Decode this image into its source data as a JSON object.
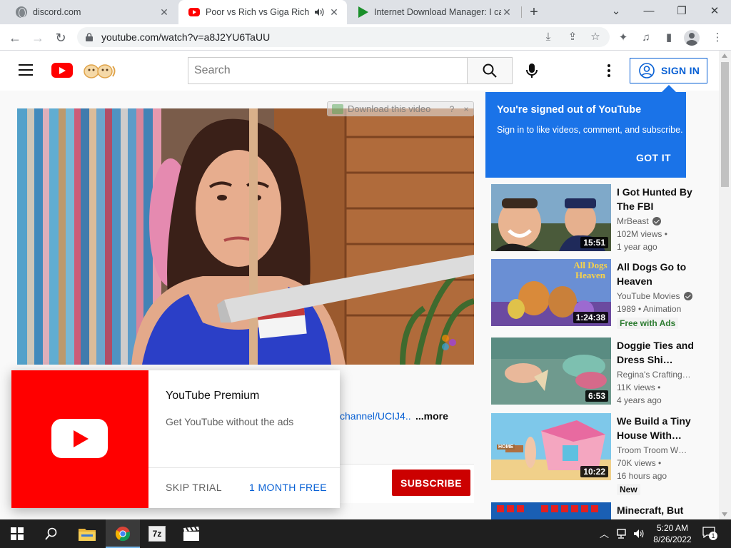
{
  "browser": {
    "tabs": [
      {
        "title": "discord.com",
        "icon": "globe-icon",
        "active": false
      },
      {
        "title": "Poor vs Rich vs Giga Rich Pre",
        "icon": "youtube-icon",
        "active": true,
        "audio": "speaker-icon"
      },
      {
        "title": "Internet Download Manager: I ca",
        "icon": "idm-icon",
        "active": false
      }
    ],
    "url": "youtube.com/watch?v=a8J2YU6TaUU"
  },
  "youtube": {
    "search_placeholder": "Search",
    "sign_in_label": "SIGN IN",
    "signed_out_bubble": {
      "title": "You're signed out of YouTube",
      "text": "Sign in to like videos, comment, and subscribe.",
      "button": "GOT IT"
    },
    "download_panel": {
      "label": "Download this video",
      "help": "?",
      "close": "×"
    },
    "description": {
      "link": "channel/UCIJ4..",
      "more": "...more"
    },
    "subscribe_label": "SUBSCRIBE",
    "premium_popup": {
      "title": "YouTube Premium",
      "subtitle": "Get YouTube without the ads",
      "skip_label": "SKIP TRIAL",
      "free_label": "1 MONTH FREE"
    },
    "recommendations": [
      {
        "title": "I Got Hunted By The FBI",
        "channel": "MrBeast",
        "verified": true,
        "views": "102M views •",
        "age": "1 year ago",
        "duration": "15:51",
        "badge": ""
      },
      {
        "title": "All Dogs Go to Heaven",
        "channel": "YouTube Movies",
        "verified": true,
        "views": "1989 • Animation",
        "age": "",
        "duration": "1:24:38",
        "badge": "Free with Ads",
        "thumb_text": "All Dogs Heaven"
      },
      {
        "title": "Doggie Ties and Dress Shi…",
        "channel": "Regina's Crafting…",
        "verified": false,
        "views": "11K views •",
        "age": "4 years ago",
        "duration": "6:53",
        "badge": ""
      },
      {
        "title": "We Build a Tiny House With…",
        "channel": "Troom Troom W…",
        "verified": false,
        "views": "70K views •",
        "age": "16 hours ago",
        "duration": "10:22",
        "badge": "New",
        "thumb_text": "HOME"
      },
      {
        "title": "Minecraft, But",
        "channel": "",
        "verified": false,
        "views": "",
        "age": "",
        "duration": "",
        "badge": ""
      }
    ]
  },
  "taskbar": {
    "time": "5:20 AM",
    "date": "8/26/2022",
    "notifications": "1",
    "apps": [
      "start-icon",
      "search-icon",
      "file-explorer-icon",
      "chrome-icon",
      "7zip-icon",
      "clapperboard-icon"
    ],
    "app_labels": {
      "sevenzip": "7z"
    }
  },
  "colors": {
    "youtube_red": "#ff0000",
    "link_blue": "#065fd4",
    "bubble_blue": "#1a73e8",
    "subscribe_red": "#cc0000"
  }
}
